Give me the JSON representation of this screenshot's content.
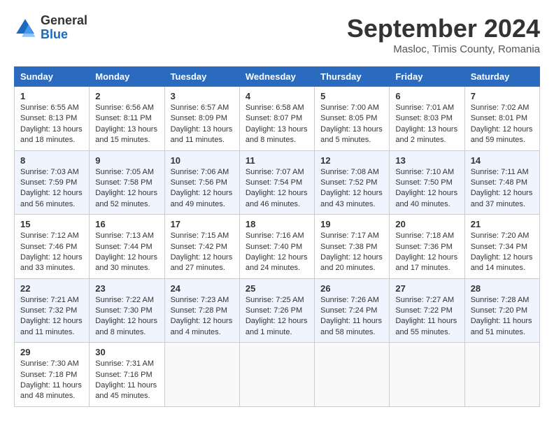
{
  "header": {
    "logo_general": "General",
    "logo_blue": "Blue",
    "month_title": "September 2024",
    "location": "Masloc, Timis County, Romania"
  },
  "weekdays": [
    "Sunday",
    "Monday",
    "Tuesday",
    "Wednesday",
    "Thursday",
    "Friday",
    "Saturday"
  ],
  "weeks": [
    [
      {
        "day": "1",
        "lines": [
          "Sunrise: 6:55 AM",
          "Sunset: 8:13 PM",
          "Daylight: 13 hours",
          "and 18 minutes."
        ]
      },
      {
        "day": "2",
        "lines": [
          "Sunrise: 6:56 AM",
          "Sunset: 8:11 PM",
          "Daylight: 13 hours",
          "and 15 minutes."
        ]
      },
      {
        "day": "3",
        "lines": [
          "Sunrise: 6:57 AM",
          "Sunset: 8:09 PM",
          "Daylight: 13 hours",
          "and 11 minutes."
        ]
      },
      {
        "day": "4",
        "lines": [
          "Sunrise: 6:58 AM",
          "Sunset: 8:07 PM",
          "Daylight: 13 hours",
          "and 8 minutes."
        ]
      },
      {
        "day": "5",
        "lines": [
          "Sunrise: 7:00 AM",
          "Sunset: 8:05 PM",
          "Daylight: 13 hours",
          "and 5 minutes."
        ]
      },
      {
        "day": "6",
        "lines": [
          "Sunrise: 7:01 AM",
          "Sunset: 8:03 PM",
          "Daylight: 13 hours",
          "and 2 minutes."
        ]
      },
      {
        "day": "7",
        "lines": [
          "Sunrise: 7:02 AM",
          "Sunset: 8:01 PM",
          "Daylight: 12 hours",
          "and 59 minutes."
        ]
      }
    ],
    [
      {
        "day": "8",
        "lines": [
          "Sunrise: 7:03 AM",
          "Sunset: 7:59 PM",
          "Daylight: 12 hours",
          "and 56 minutes."
        ]
      },
      {
        "day": "9",
        "lines": [
          "Sunrise: 7:05 AM",
          "Sunset: 7:58 PM",
          "Daylight: 12 hours",
          "and 52 minutes."
        ]
      },
      {
        "day": "10",
        "lines": [
          "Sunrise: 7:06 AM",
          "Sunset: 7:56 PM",
          "Daylight: 12 hours",
          "and 49 minutes."
        ]
      },
      {
        "day": "11",
        "lines": [
          "Sunrise: 7:07 AM",
          "Sunset: 7:54 PM",
          "Daylight: 12 hours",
          "and 46 minutes."
        ]
      },
      {
        "day": "12",
        "lines": [
          "Sunrise: 7:08 AM",
          "Sunset: 7:52 PM",
          "Daylight: 12 hours",
          "and 43 minutes."
        ]
      },
      {
        "day": "13",
        "lines": [
          "Sunrise: 7:10 AM",
          "Sunset: 7:50 PM",
          "Daylight: 12 hours",
          "and 40 minutes."
        ]
      },
      {
        "day": "14",
        "lines": [
          "Sunrise: 7:11 AM",
          "Sunset: 7:48 PM",
          "Daylight: 12 hours",
          "and 37 minutes."
        ]
      }
    ],
    [
      {
        "day": "15",
        "lines": [
          "Sunrise: 7:12 AM",
          "Sunset: 7:46 PM",
          "Daylight: 12 hours",
          "and 33 minutes."
        ]
      },
      {
        "day": "16",
        "lines": [
          "Sunrise: 7:13 AM",
          "Sunset: 7:44 PM",
          "Daylight: 12 hours",
          "and 30 minutes."
        ]
      },
      {
        "day": "17",
        "lines": [
          "Sunrise: 7:15 AM",
          "Sunset: 7:42 PM",
          "Daylight: 12 hours",
          "and 27 minutes."
        ]
      },
      {
        "day": "18",
        "lines": [
          "Sunrise: 7:16 AM",
          "Sunset: 7:40 PM",
          "Daylight: 12 hours",
          "and 24 minutes."
        ]
      },
      {
        "day": "19",
        "lines": [
          "Sunrise: 7:17 AM",
          "Sunset: 7:38 PM",
          "Daylight: 12 hours",
          "and 20 minutes."
        ]
      },
      {
        "day": "20",
        "lines": [
          "Sunrise: 7:18 AM",
          "Sunset: 7:36 PM",
          "Daylight: 12 hours",
          "and 17 minutes."
        ]
      },
      {
        "day": "21",
        "lines": [
          "Sunrise: 7:20 AM",
          "Sunset: 7:34 PM",
          "Daylight: 12 hours",
          "and 14 minutes."
        ]
      }
    ],
    [
      {
        "day": "22",
        "lines": [
          "Sunrise: 7:21 AM",
          "Sunset: 7:32 PM",
          "Daylight: 12 hours",
          "and 11 minutes."
        ]
      },
      {
        "day": "23",
        "lines": [
          "Sunrise: 7:22 AM",
          "Sunset: 7:30 PM",
          "Daylight: 12 hours",
          "and 8 minutes."
        ]
      },
      {
        "day": "24",
        "lines": [
          "Sunrise: 7:23 AM",
          "Sunset: 7:28 PM",
          "Daylight: 12 hours",
          "and 4 minutes."
        ]
      },
      {
        "day": "25",
        "lines": [
          "Sunrise: 7:25 AM",
          "Sunset: 7:26 PM",
          "Daylight: 12 hours",
          "and 1 minute."
        ]
      },
      {
        "day": "26",
        "lines": [
          "Sunrise: 7:26 AM",
          "Sunset: 7:24 PM",
          "Daylight: 11 hours",
          "and 58 minutes."
        ]
      },
      {
        "day": "27",
        "lines": [
          "Sunrise: 7:27 AM",
          "Sunset: 7:22 PM",
          "Daylight: 11 hours",
          "and 55 minutes."
        ]
      },
      {
        "day": "28",
        "lines": [
          "Sunrise: 7:28 AM",
          "Sunset: 7:20 PM",
          "Daylight: 11 hours",
          "and 51 minutes."
        ]
      }
    ],
    [
      {
        "day": "29",
        "lines": [
          "Sunrise: 7:30 AM",
          "Sunset: 7:18 PM",
          "Daylight: 11 hours",
          "and 48 minutes."
        ]
      },
      {
        "day": "30",
        "lines": [
          "Sunrise: 7:31 AM",
          "Sunset: 7:16 PM",
          "Daylight: 11 hours",
          "and 45 minutes."
        ]
      },
      {
        "day": "",
        "lines": []
      },
      {
        "day": "",
        "lines": []
      },
      {
        "day": "",
        "lines": []
      },
      {
        "day": "",
        "lines": []
      },
      {
        "day": "",
        "lines": []
      }
    ]
  ]
}
